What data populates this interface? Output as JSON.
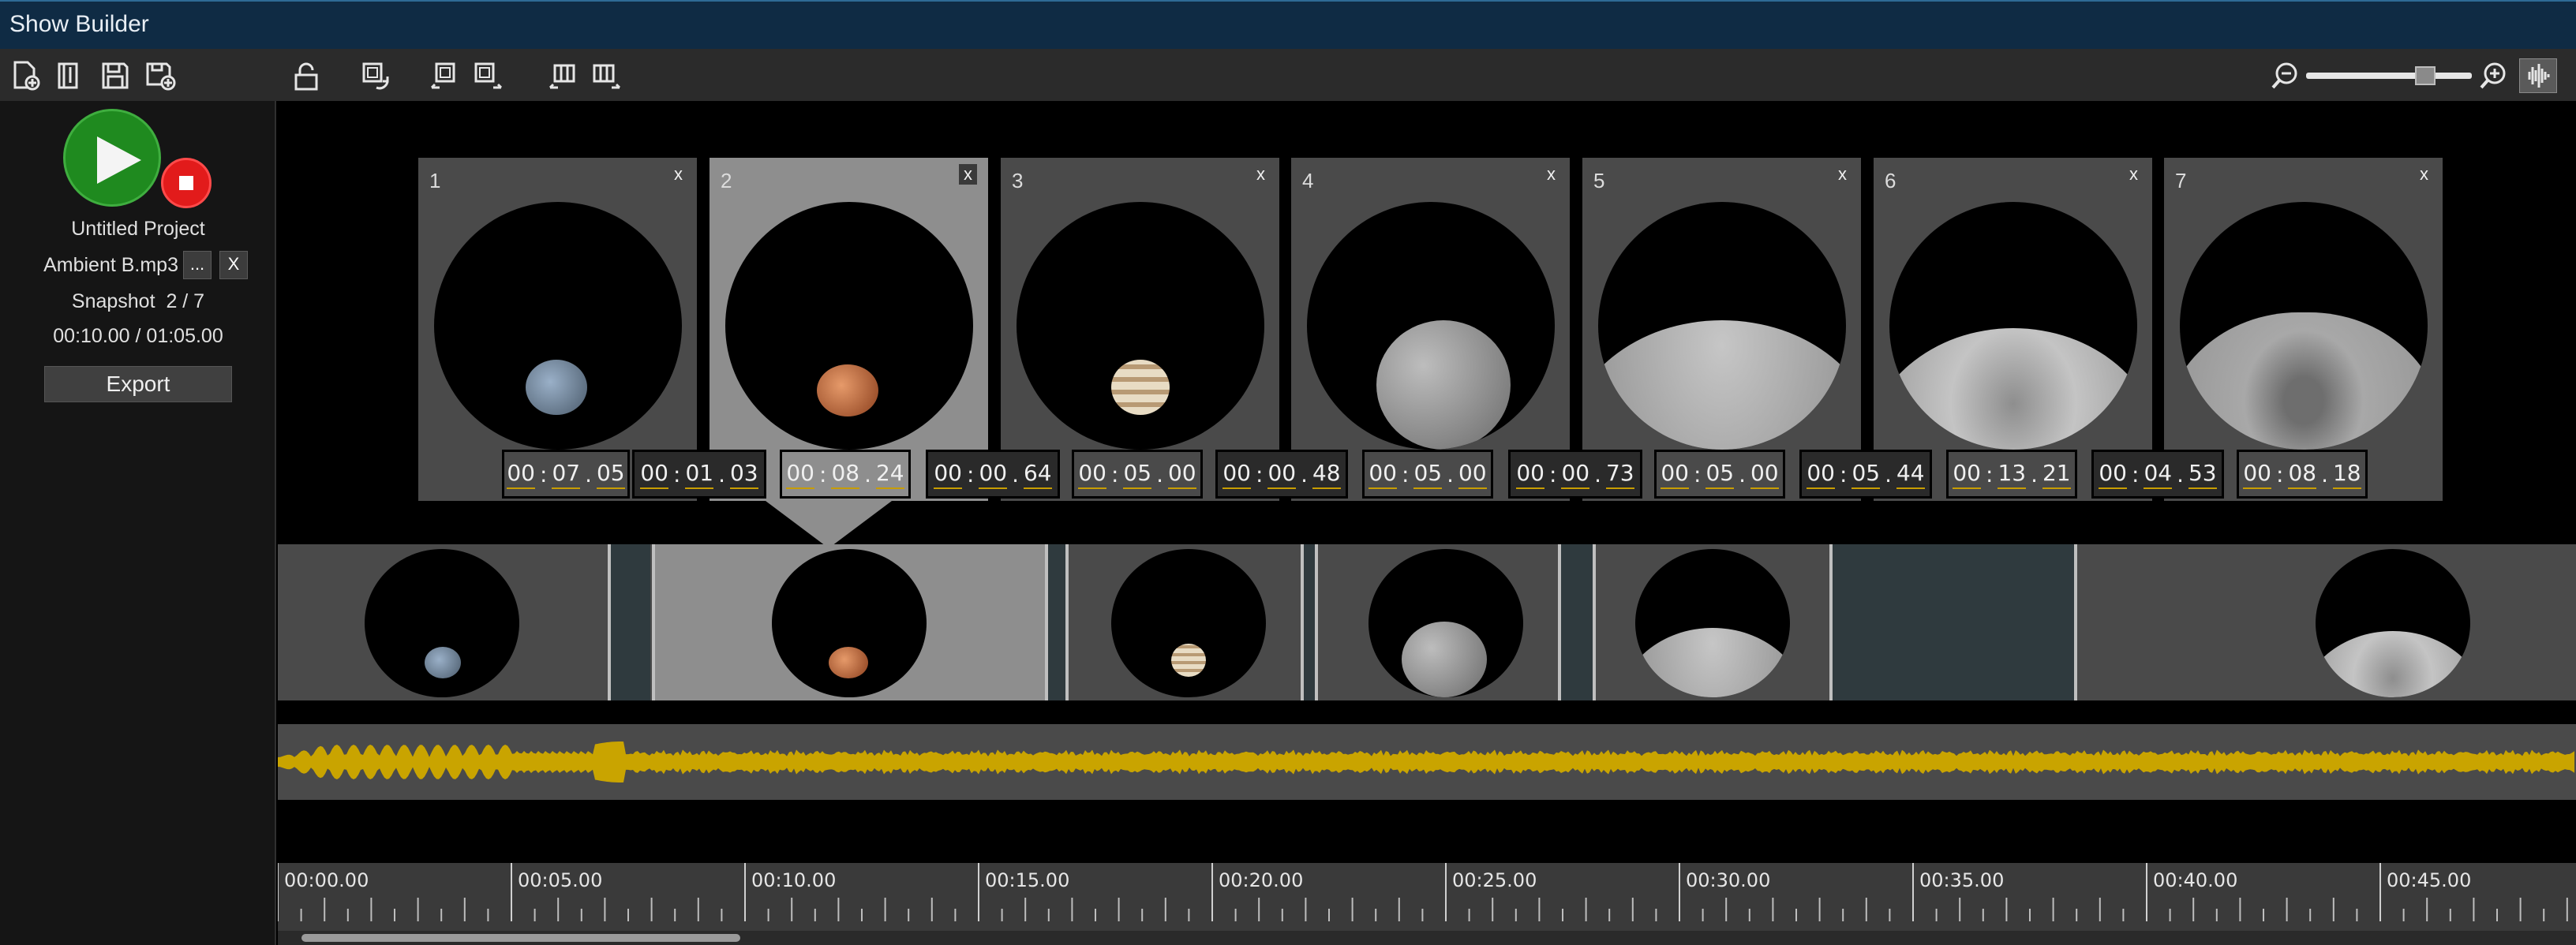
{
  "app": {
    "title": "Show Builder"
  },
  "toolbar": {
    "buttons": [
      "new-project-icon",
      "open-project-icon",
      "save-icon",
      "save-as-icon",
      "lock-icon",
      "snapshot-refresh-icon",
      "zoom-fit-left-icon",
      "zoom-fit-right-icon",
      "column-left-icon",
      "column-right-icon"
    ],
    "zoom_level": 0.72
  },
  "left_panel": {
    "project_name": "Untitled Project",
    "audio_file": "Ambient B.mp3",
    "browse_label": "...",
    "remove_label": "X",
    "snapshot_label": "Snapshot",
    "snapshot_index": "2 / 7",
    "time_display": "00:10.00 / 01:05.00",
    "export_label": "Export"
  },
  "snapshots": [
    {
      "number": "1",
      "close": "x",
      "body": "planet-small-gray"
    },
    {
      "number": "2",
      "close": "x",
      "body": "mars"
    },
    {
      "number": "3",
      "close": "x",
      "body": "jupiter"
    },
    {
      "number": "4",
      "close": "x",
      "body": "moon"
    },
    {
      "number": "5",
      "close": "x",
      "body": "moon-horizon"
    },
    {
      "number": "6",
      "close": "x",
      "body": "crater-horizon"
    },
    {
      "number": "7",
      "close": "x",
      "body": "crater-closeup"
    }
  ],
  "time_fields": [
    {
      "hh": "00",
      "mm": "07",
      "ss": "05"
    },
    {
      "hh": "00",
      "mm": "01",
      "ss": "03"
    },
    {
      "hh": "00",
      "mm": "08",
      "ss": "24"
    },
    {
      "hh": "00",
      "mm": "00",
      "ss": "64"
    },
    {
      "hh": "00",
      "mm": "05",
      "ss": "00"
    },
    {
      "hh": "00",
      "mm": "00",
      "ss": "48"
    },
    {
      "hh": "00",
      "mm": "05",
      "ss": "00"
    },
    {
      "hh": "00",
      "mm": "00",
      "ss": "73"
    },
    {
      "hh": "00",
      "mm": "05",
      "ss": "00"
    },
    {
      "hh": "00",
      "mm": "05",
      "ss": "44"
    },
    {
      "hh": "00",
      "mm": "13",
      "ss": "21"
    },
    {
      "hh": "00",
      "mm": "04",
      "ss": "53"
    },
    {
      "hh": "00",
      "mm": "08",
      "ss": "18"
    }
  ],
  "ruler": {
    "labels": [
      "00:00.00",
      "00:05.00",
      "00:10.00",
      "00:15.00",
      "00:20.00",
      "00:25.00",
      "00:30.00",
      "00:35.00",
      "00:40.00",
      "00:45.00"
    ]
  },
  "colors": {
    "title_bar": "#0f2b44",
    "play": "#1f8a1f",
    "stop": "#e21b1b",
    "waveform": "#c9a400",
    "selected_card": "#8e8e8e"
  }
}
